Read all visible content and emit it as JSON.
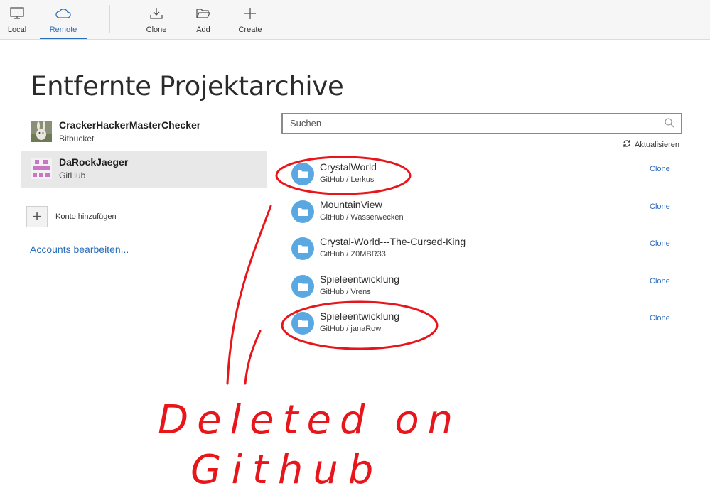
{
  "toolbar": {
    "buttons": [
      {
        "label": "Local",
        "icon": "monitor-icon"
      },
      {
        "label": "Remote",
        "icon": "cloud-icon",
        "active": true
      },
      {
        "label": "Clone",
        "icon": "download-icon"
      },
      {
        "label": "Add",
        "icon": "folder-open-icon"
      },
      {
        "label": "Create",
        "icon": "plus-icon"
      }
    ]
  },
  "page": {
    "title": "Entfernte Projektarchive"
  },
  "accounts": [
    {
      "name": "CrackerHackerMasterChecker",
      "host": "Bitbucket",
      "selected": false
    },
    {
      "name": "DaRockJaeger",
      "host": "GitHub",
      "selected": true
    }
  ],
  "add_account_label": "Konto hinzufügen",
  "edit_accounts_label": "Accounts bearbeiten...",
  "search": {
    "placeholder": "Suchen"
  },
  "refresh_label": "Aktualisieren",
  "repos": [
    {
      "name": "CrystalWorld",
      "path": "GitHub / Lerkus",
      "action": "Clone"
    },
    {
      "name": "MountainView",
      "path": "GitHub / Wasserwecken",
      "action": "Clone"
    },
    {
      "name": "Crystal-World---The-Cursed-King",
      "path": "GitHub / Z0MBR33",
      "action": "Clone"
    },
    {
      "name": "Spieleentwicklung",
      "path": "GitHub / Vrens",
      "action": "Clone"
    },
    {
      "name": "Spieleentwicklung",
      "path": "GitHub / janaRow",
      "action": "Clone"
    }
  ],
  "annotation": {
    "line1": "Deleted on",
    "line2": "Github",
    "color": "#e8151b"
  },
  "colors": {
    "accent": "#2a6db8",
    "folder": "#5aa8e2",
    "selected_bg": "#e8e8e8"
  }
}
